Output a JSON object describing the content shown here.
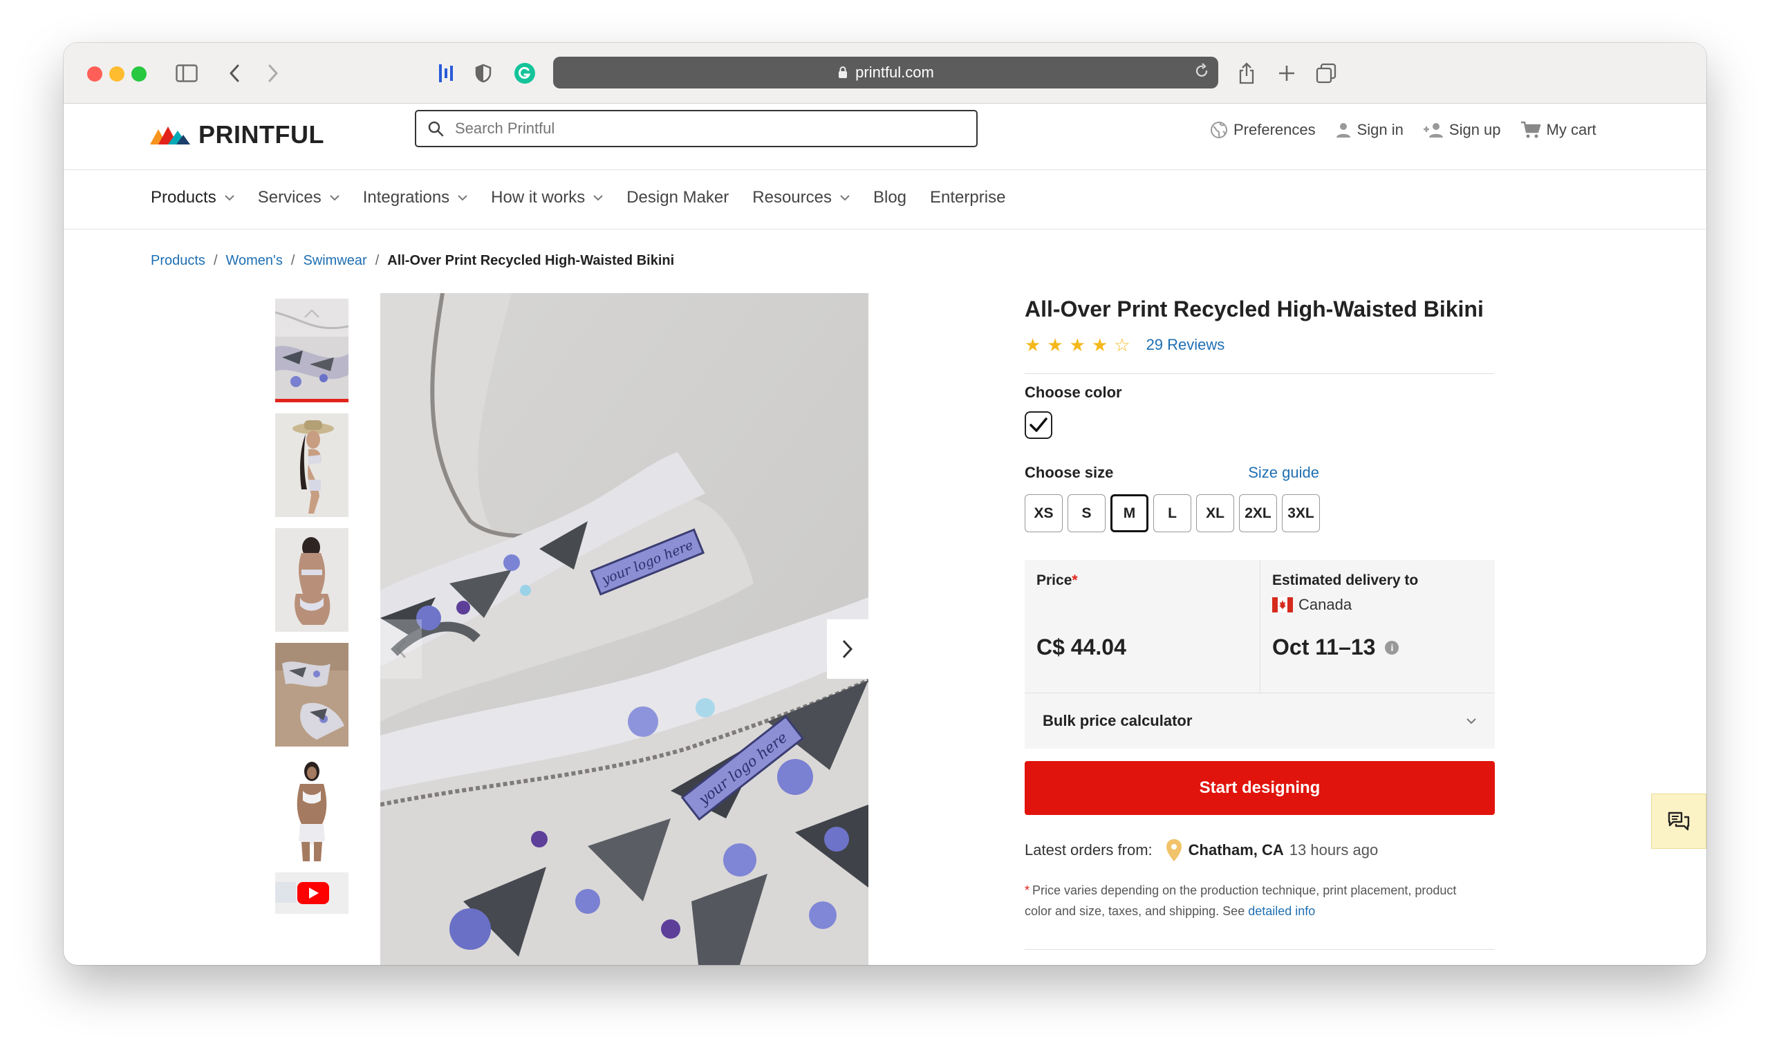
{
  "browser": {
    "url": "printful.com"
  },
  "header": {
    "logo_text": "PRINTFUL",
    "search_placeholder": "Search Printful",
    "links": {
      "preferences": "Preferences",
      "sign_in": "Sign in",
      "sign_up": "Sign up",
      "cart": "My cart"
    }
  },
  "nav": {
    "items": [
      "Products",
      "Services",
      "Integrations",
      "How it works",
      "Design Maker",
      "Resources",
      "Blog",
      "Enterprise"
    ]
  },
  "breadcrumb": {
    "items": [
      "Products",
      "Women's",
      "Swimwear"
    ],
    "current": "All-Over Print Recycled High-Waisted Bikini"
  },
  "product": {
    "title": "All-Over Print Recycled High-Waisted Bikini",
    "rating": 4,
    "rating_max": 5,
    "reviews": "29 Reviews",
    "choose_color_label": "Choose color",
    "choose_size_label": "Choose size",
    "size_guide": "Size guide",
    "sizes": [
      "XS",
      "S",
      "M",
      "L",
      "XL",
      "2XL",
      "3XL"
    ],
    "selected_size": "M",
    "price_label": "Price",
    "price_required_mark": "*",
    "price": "C$ 44.04",
    "delivery_label": "Estimated delivery to",
    "delivery_country": "Canada",
    "delivery_dates": "Oct 11–13",
    "bulk_calculator": "Bulk price calculator",
    "start_button": "Start designing",
    "latest_orders_label": "Latest orders from:",
    "latest_location": "Chatham, CA",
    "latest_time": "13 hours ago",
    "note_mark": "*",
    "note_text": "Price varies depending on the production technique, print placement, product color and size, taxes, and shipping. See",
    "note_link": "detailed info"
  },
  "image_overlay_text": {
    "logo_placeholder_1": "your logo here",
    "logo_placeholder_2": "your logo here"
  },
  "colors": {
    "accent_red": "#e0140c",
    "link_blue": "#1f6fb2",
    "star_yellow": "#f5b81c"
  }
}
